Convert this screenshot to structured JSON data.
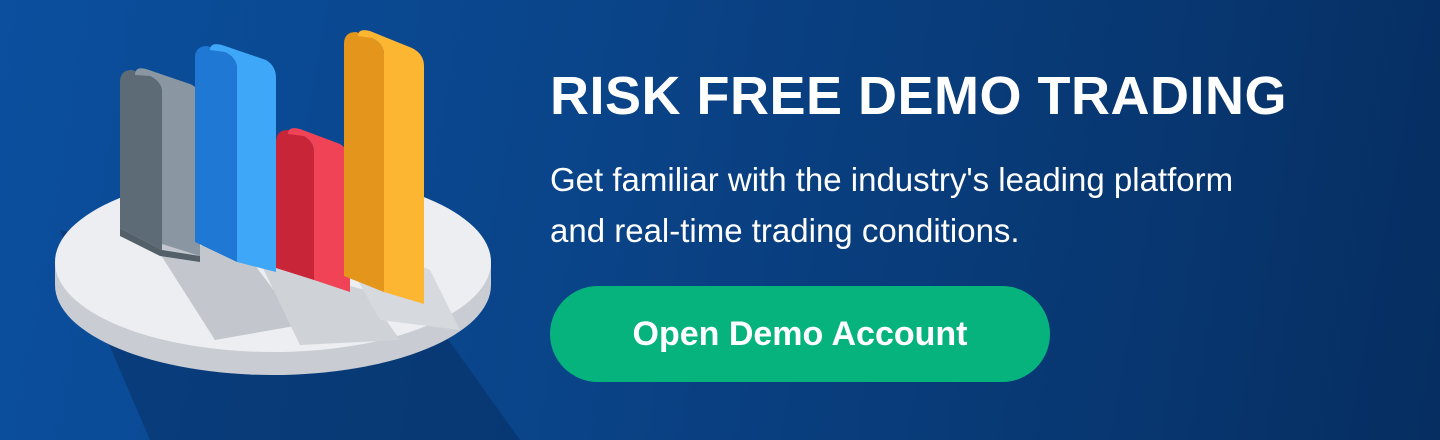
{
  "banner": {
    "headline": "RISK FREE DEMO TRADING",
    "subtext_line1": "Get familiar with the industry's leading platform",
    "subtext_line2": "and real-time trading conditions.",
    "cta_label": "Open Demo Account"
  },
  "colors": {
    "background": "#0a4489",
    "button": "#06b37d",
    "bar_gray": "#7d8c98",
    "bar_blue": "#2f9bf3",
    "bar_red": "#ee3b4f",
    "bar_orange": "#fbb034"
  },
  "illustration": {
    "icon": "bar-chart-on-platform-icon"
  }
}
